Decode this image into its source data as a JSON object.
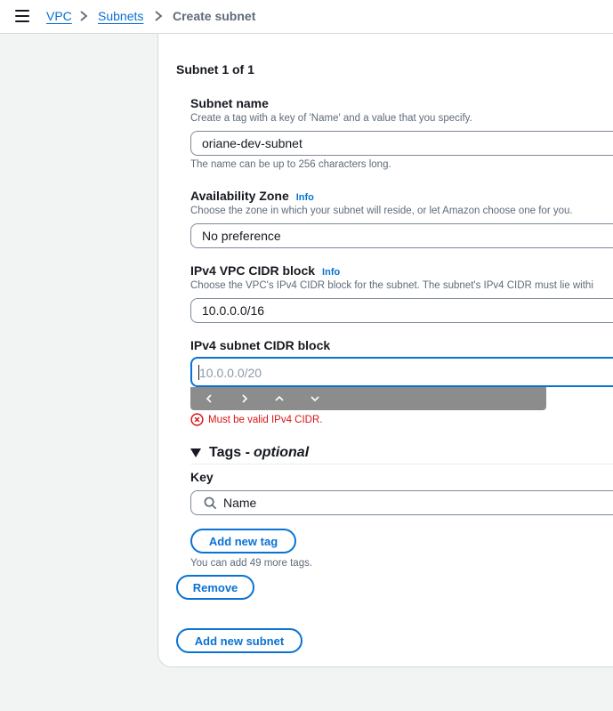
{
  "breadcrumb": {
    "items": [
      {
        "label": "VPC"
      },
      {
        "label": "Subnets"
      }
    ],
    "current": "Create subnet"
  },
  "subnet": {
    "heading": "Subnet 1 of 1",
    "name": {
      "label": "Subnet name",
      "description": "Create a tag with a key of 'Name' and a value that you specify.",
      "value": "oriane-dev-subnet",
      "hint": "The name can be up to 256 characters long."
    },
    "az": {
      "label": "Availability Zone",
      "info": "Info",
      "description": "Choose the zone in which your subnet will reside, or let Amazon choose one for you.",
      "value": "No preference"
    },
    "vpc_cidr": {
      "label": "IPv4 VPC CIDR block",
      "info": "Info",
      "description": "Choose the VPC's IPv4 CIDR block for the subnet. The subnet's IPv4 CIDR must lie withi",
      "value": "10.0.0.0/16"
    },
    "subnet_cidr": {
      "label": "IPv4 subnet CIDR block",
      "placeholder": "10.0.0.0/20",
      "error": "Must be valid IPv4 CIDR."
    },
    "tags": {
      "title": "Tags -",
      "optional": "optional",
      "key_label": "Key",
      "key_value": "Name",
      "add_tag_button": "Add new tag",
      "remaining": "You can add 49 more tags."
    },
    "remove_button": "Remove"
  },
  "add_subnet_button": "Add new subnet",
  "icons": {
    "menu": "hamburger-menu-icon",
    "separator": "chevron-right-icon",
    "error": "error-circle-icon",
    "expand": "triangle-down-icon",
    "search": "search-icon"
  },
  "colors": {
    "link": "#0972d3",
    "error": "#d91515",
    "text": "#16191f",
    "muted": "#5f6b7a"
  }
}
